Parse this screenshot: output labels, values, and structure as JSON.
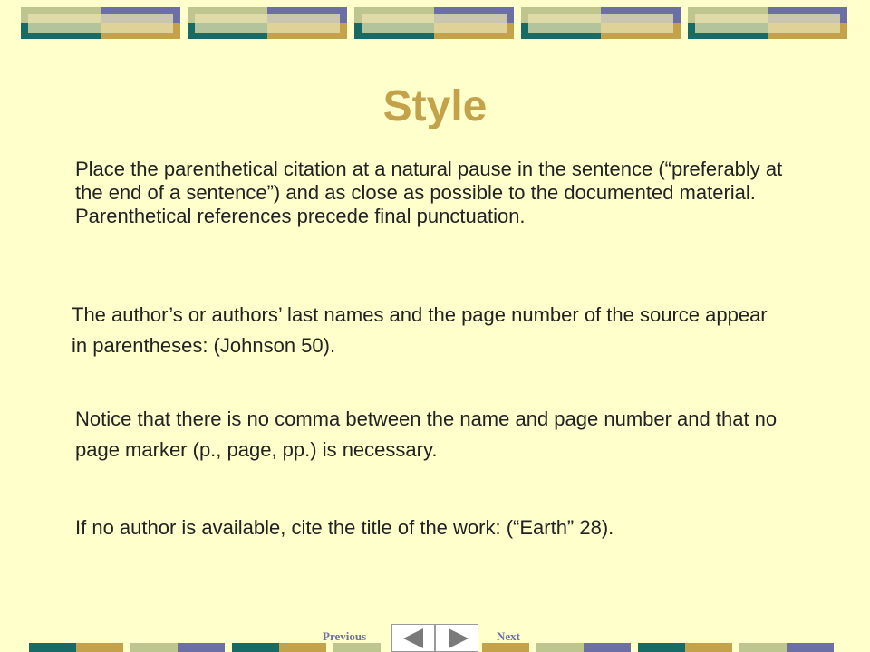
{
  "slide": {
    "title": "Style",
    "paragraphs": [
      "Place the parenthetical citation at a natural pause in the sentence (“preferably at the end of a sentence”) and as close as possible to the documented material.  Parenthetical references precede final punctuation.",
      "The author’s or authors’ last names and the page number of the source appear in parentheses: (Johnson 50).",
      "Notice that there is no comma between the name and page number and that no page marker (p., page, pp.) is necessary.",
      "If no author is available, cite the title of the work: (“Earth” 28)."
    ]
  },
  "navigation": {
    "previous_label": "Previous",
    "next_label": "Next",
    "previous_icon": "triangle-left-icon",
    "next_icon": "triangle-right-icon"
  },
  "colors": {
    "background": "#ffffcc",
    "title": "#c4a24a",
    "teal": "#166b66",
    "olive": "#bfc58f",
    "violet": "#6b6fa6",
    "gold": "#c4a24a"
  }
}
